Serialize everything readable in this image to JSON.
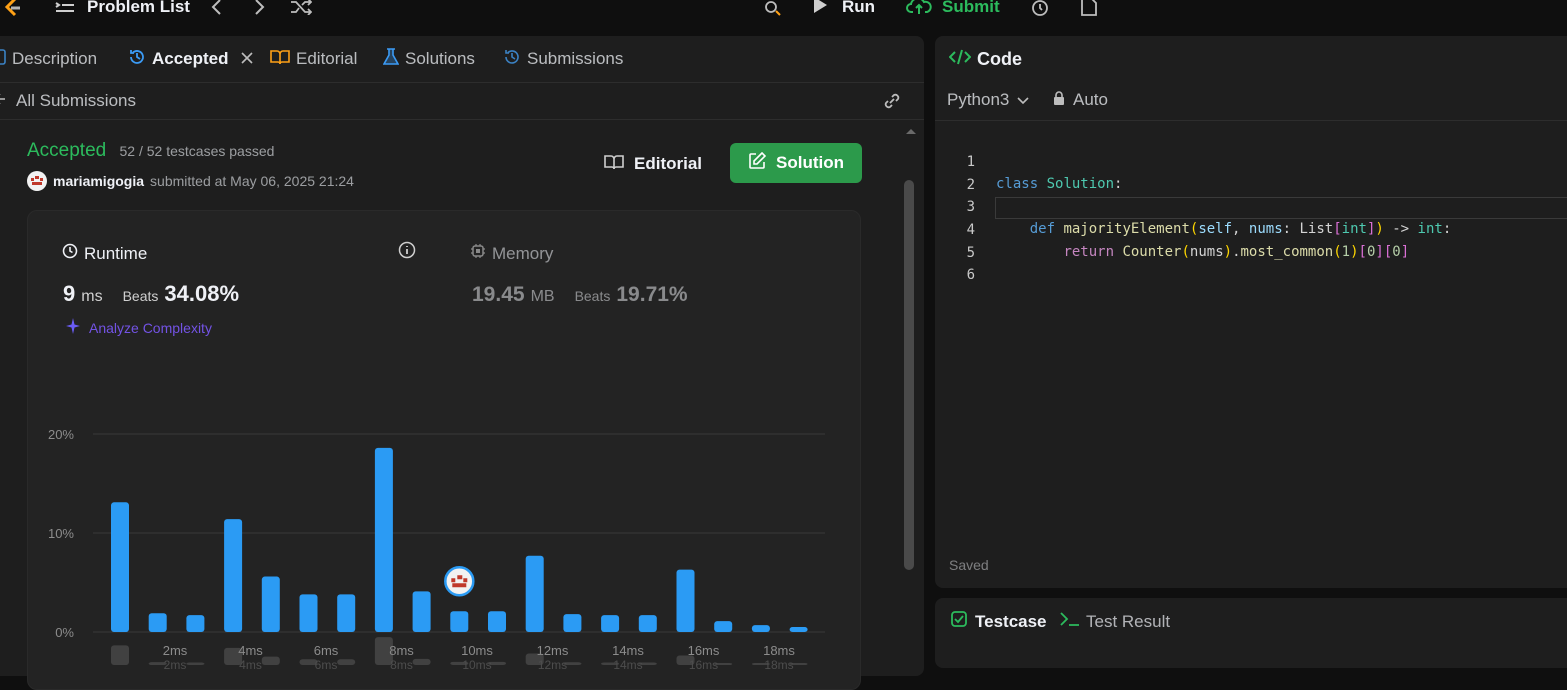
{
  "topbar": {
    "problem_list": "Problem List",
    "run": "Run",
    "submit": "Submit"
  },
  "tabs": [
    {
      "label": "Description",
      "active": false
    },
    {
      "label": "Accepted",
      "active": true
    },
    {
      "label": "Editorial",
      "active": false
    },
    {
      "label": "Solutions",
      "active": false
    },
    {
      "label": "Submissions",
      "active": false
    }
  ],
  "subbar": {
    "back": "All Submissions"
  },
  "result": {
    "status": "Accepted",
    "testcases": "52 / 52 testcases passed",
    "username": "mariamigogia",
    "submitted_at": "submitted at May 06, 2025 21:24",
    "editorial_btn": "Editorial",
    "solution_btn": "Solution"
  },
  "runtime": {
    "title": "Runtime",
    "value": "9",
    "unit": "ms",
    "beats_label": "Beats",
    "beats_value": "34.08%",
    "analyze": "Analyze Complexity"
  },
  "memory": {
    "title": "Memory",
    "value": "19.45",
    "unit": "MB",
    "beats_label": "Beats",
    "beats_value": "19.71%"
  },
  "chart_data": {
    "type": "bar",
    "y_ticks": [
      "20%",
      "10%",
      "0%"
    ],
    "ylim": [
      0,
      20
    ],
    "x_ticks": [
      "2ms",
      "4ms",
      "6ms",
      "8ms",
      "10ms",
      "12ms",
      "14ms",
      "16ms",
      "18ms"
    ],
    "values": [
      13.1,
      1.9,
      1.7,
      11.4,
      5.6,
      3.8,
      3.8,
      18.6,
      4.1,
      2.1,
      2.1,
      7.7,
      1.8,
      1.7,
      1.7,
      6.3,
      1.1,
      0.7,
      0.5
    ],
    "user_bar_index": 9,
    "bar_color": "#2b9bf4"
  },
  "editor": {
    "title": "Code",
    "language": "Python3",
    "auto": "Auto",
    "saved": "Saved",
    "line_numbers": [
      "1",
      "2",
      "3",
      "4",
      "5",
      "6"
    ]
  },
  "bottom": {
    "testcase": "Testcase",
    "test_result": "Test Result"
  }
}
